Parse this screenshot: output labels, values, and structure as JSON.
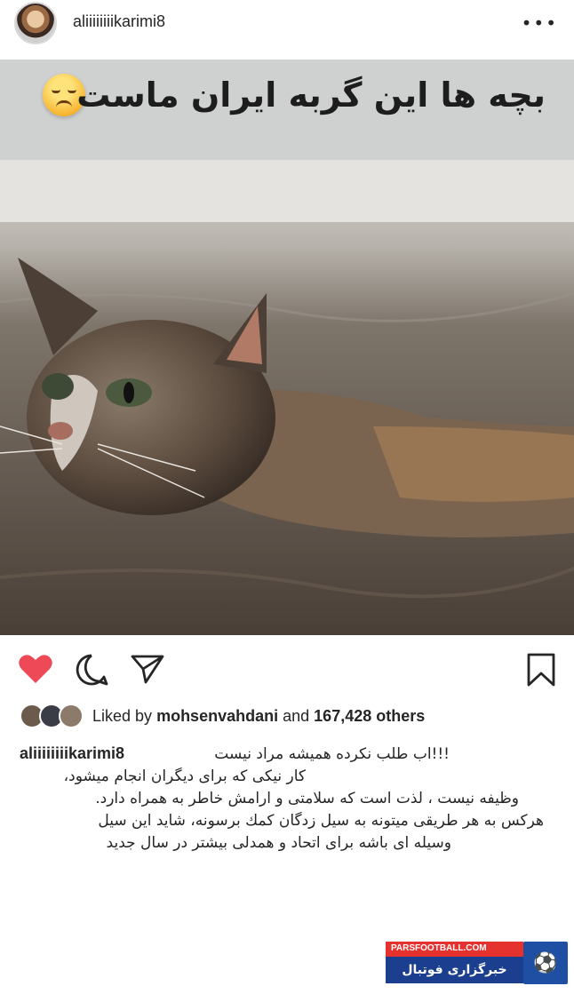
{
  "header": {
    "username": "aliiiiiiiikarimi8",
    "more_icon": "more-dots-icon",
    "more_glyph": "•••"
  },
  "post": {
    "banner_text": "بچه ها این گربه ایران ماست",
    "banner_emoji": "sad-face-emoji"
  },
  "actions": {
    "like_icon": "heart-filled-icon",
    "comment_icon": "comment-icon",
    "share_icon": "share-icon",
    "save_icon": "bookmark-icon",
    "like_color": "#ed4956"
  },
  "likes": {
    "prefix": "Liked by",
    "first_liker": "mohsenvahdani",
    "joiner": "and",
    "others": "167,428 others"
  },
  "caption": {
    "username": "aliiiiiiiikarimi8",
    "line1": "!!!اب طلب نکرده همیشه مراد نیست",
    "line2": "کار نیکی که برای دیگران انجام میشود،",
    "line3": "وظیفه نیست ، لذت است که سلامتی و ارامش خاطر به همراه دارد.",
    "line4": "هرکس به هر طریقی میتونه به سیل زدگان کمك برسونه، شاید این سیل",
    "line5": "وسیله ای باشه برای اتحاد و همدلی بیشتر در سال جدید"
  },
  "watermark": {
    "site": "PARSFOOTBALL.COM",
    "name": "خبرگزاری فوتبال ایران"
  }
}
